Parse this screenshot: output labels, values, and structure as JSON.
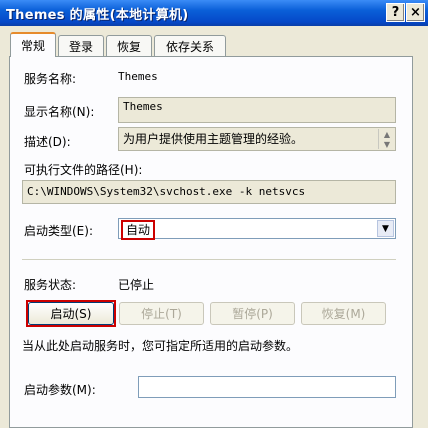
{
  "window": {
    "title": "Themes 的属性(本地计算机)",
    "help_label": "?",
    "close_label": "×"
  },
  "tabs": [
    {
      "label": "常规",
      "active": true
    },
    {
      "label": "登录",
      "active": false
    },
    {
      "label": "恢复",
      "active": false
    },
    {
      "label": "依存关系",
      "active": false
    }
  ],
  "general": {
    "service_name_label": "服务名称:",
    "service_name_value": "Themes",
    "display_name_label": "显示名称(N):",
    "display_name_value": "Themes",
    "description_label": "描述(D):",
    "description_value": "为用户提供使用主题管理的经验。",
    "path_label": "可执行文件的路径(H):",
    "path_value": "C:\\WINDOWS\\System32\\svchost.exe -k netsvcs",
    "startup_type_label": "启动类型(E):",
    "startup_type_value": "自动",
    "service_status_label": "服务状态:",
    "service_status_value": "已停止",
    "buttons": {
      "start": "启动(S)",
      "stop": "停止(T)",
      "pause": "暂停(P)",
      "resume": "恢复(M)"
    },
    "hint": "当从此处启动服务时，您可指定所适用的启动参数。",
    "start_params_label": "启动参数(M):",
    "start_params_value": ""
  },
  "colors": {
    "titlebar": "#0a5fd8",
    "highlight_box": "#cc0000",
    "active_tab_accent": "#e68b2c"
  }
}
